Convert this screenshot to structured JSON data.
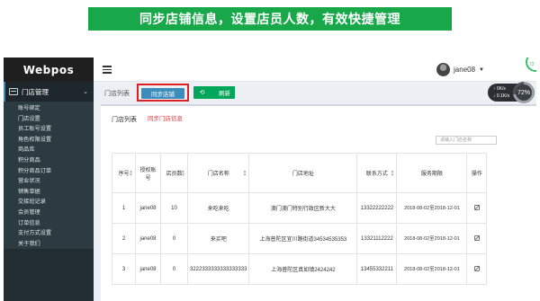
{
  "banner": {
    "text": "同步店铺信息，设置店员人数，有效快捷管理"
  },
  "sidebar": {
    "brand": "Webpos",
    "section": {
      "label": "门店管理",
      "icon": "store-icon"
    },
    "items": [
      {
        "label": "账号绑定"
      },
      {
        "label": "门店设置"
      },
      {
        "label": "员工账号设置"
      },
      {
        "label": "角色权限设置"
      },
      {
        "label": "商品库"
      },
      {
        "label": "积分商品"
      },
      {
        "label": "积分商品订单"
      },
      {
        "label": "营业状况"
      },
      {
        "label": "销售单据"
      },
      {
        "label": "交接班记录"
      },
      {
        "label": "会员管理"
      },
      {
        "label": "订单信息"
      },
      {
        "label": "支付方式设置"
      },
      {
        "label": "关于我们"
      }
    ]
  },
  "topbar": {
    "username": "jane08"
  },
  "stats": {
    "line1": "↑ 0K/s",
    "line2": "↓ 0.1K/s",
    "percent": "72%",
    "corner": "72"
  },
  "toolbar": {
    "tab_label": "门店列表",
    "sync_label": "同步店铺",
    "refresh_label": "刷新"
  },
  "box": {
    "title": "门店列表",
    "title_red": "同步门店信息",
    "search_placeholder": "请输入门店名称"
  },
  "table": {
    "headers": [
      "序号",
      "授权账号",
      "店员数",
      "门店名称",
      "门店地址",
      "联系方式",
      "服务期限",
      "操作"
    ],
    "rows": [
      {
        "no": "1",
        "account": "jane08",
        "staff": "10",
        "name": "来吃来吃",
        "address": "澳门澳门特别行政区新大大",
        "contact": "13322222222",
        "term": "2018-08-02至2018-12-01"
      },
      {
        "no": "2",
        "account": "jane08",
        "staff": "0",
        "name": "来买吧",
        "address": "上海普陀区宜川路街道34534535353",
        "contact": "13321112222",
        "term": "2018-08-02至2018-12-01"
      },
      {
        "no": "3",
        "account": "jane08",
        "staff": "0",
        "name": "3222333333333333333",
        "address": "上海普陀区真如镇2424242",
        "contact": "13455332211",
        "term": "2018-08-02至2018-12-01"
      }
    ]
  }
}
